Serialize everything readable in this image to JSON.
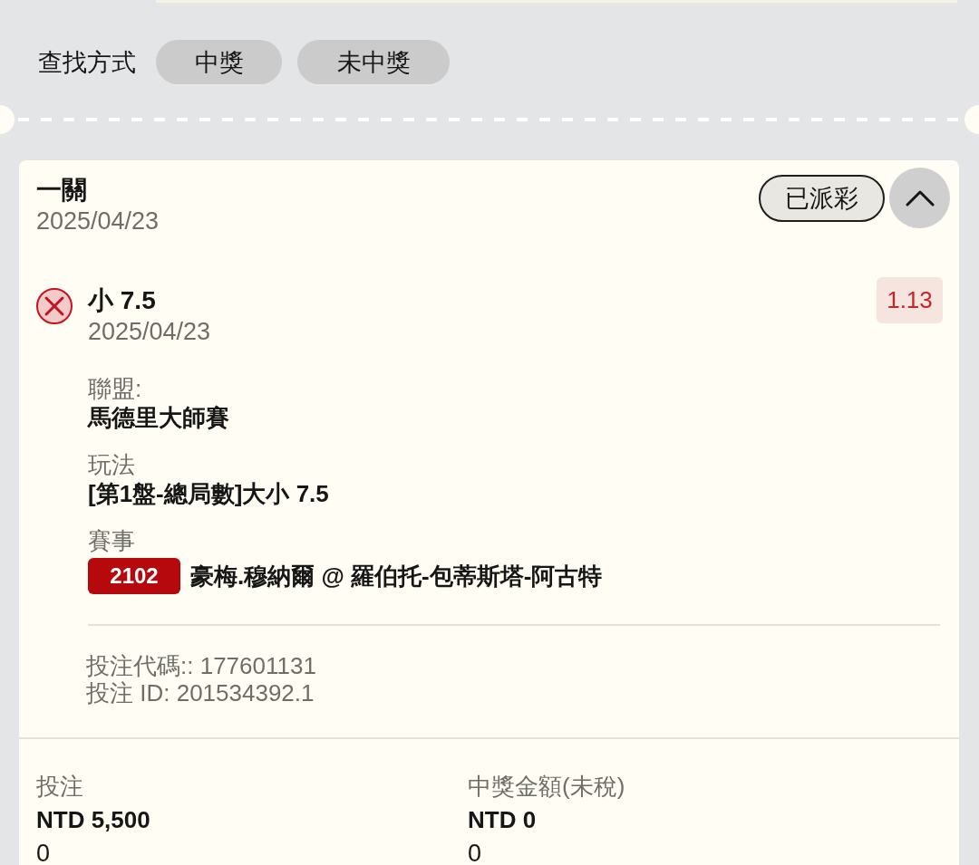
{
  "filter": {
    "label": "查找方式",
    "options": [
      {
        "label": "中獎",
        "selected": false
      },
      {
        "label": "未中獎",
        "selected": false
      }
    ]
  },
  "bet": {
    "title": "一關",
    "date": "2025/04/23",
    "status": "已派彩",
    "expanded": true,
    "selections": [
      {
        "won": false,
        "name": "小 7.5",
        "date": "2025/04/23",
        "odds": "1.13",
        "fields": [
          {
            "label": "聯盟:",
            "value": "馬德里大師賽"
          },
          {
            "label": "玩法",
            "value": "[第1盤-總局數]大小 7.5"
          },
          {
            "label": "賽事",
            "event_code": "2102",
            "value": "豪梅.穆納爾 @ 羅伯托-包蒂斯塔-阿古特"
          }
        ]
      }
    ],
    "codes": [
      "投注代碼:: 177601131",
      "投注 ID: 201534392.1"
    ],
    "totals": [
      {
        "label": "投注",
        "amount": "NTD 5,500",
        "extra": "0"
      },
      {
        "label": "中獎金額(未稅)",
        "amount": "NTD 0",
        "extra": "0"
      }
    ]
  }
}
